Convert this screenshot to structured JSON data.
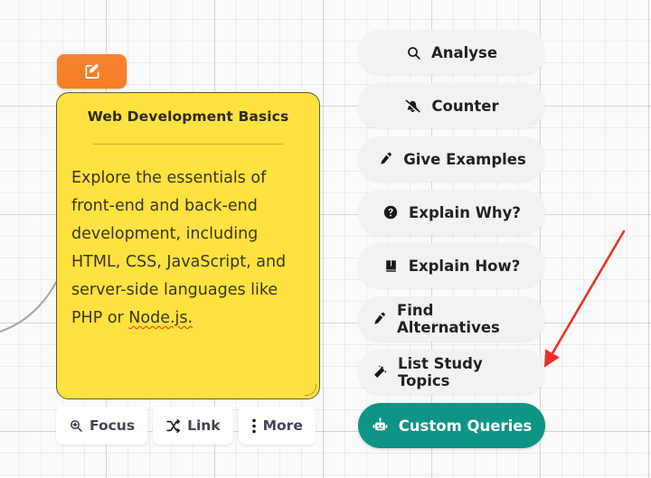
{
  "canvas": {
    "grid": true,
    "background_color": "#fafafa",
    "grid_minor_color": "#ebebeb",
    "grid_major_color": "#e0e0e0"
  },
  "connector": {
    "name": "edge-curve",
    "color": "#a8a8a8"
  },
  "edit_badge": {
    "icon": "edit-square-icon",
    "color": "#f47d24"
  },
  "note": {
    "title": "Web Development Basics",
    "body_lines": [
      "Explore the essentials of",
      "front-end and back-end",
      "development, including",
      "HTML, CSS, JavaScript, and",
      "server-side languages like",
      "PHP or "
    ],
    "misspelled_word": "Node.js.",
    "background_color": "#ffe13f",
    "border_color": "#5e5a33",
    "spellcheck_color": "#e8342a"
  },
  "note_toolbar": {
    "buttons": [
      {
        "label": "Focus",
        "icon": "magnify-plus-icon"
      },
      {
        "label": "Link",
        "icon": "shuffle-icon"
      },
      {
        "label": "More",
        "icon": "dots-vertical-icon"
      }
    ]
  },
  "action_menu": {
    "accent_color": "#0e9484",
    "items": [
      {
        "label": "Analyse",
        "icon": "search-icon",
        "active": false
      },
      {
        "label": "Counter",
        "icon": "bell-slash-icon",
        "active": false
      },
      {
        "label": "Give Examples",
        "icon": "pen-icon",
        "active": false
      },
      {
        "label": "Explain Why?",
        "icon": "question-circle-icon",
        "active": false
      },
      {
        "label": "Explain How?",
        "icon": "book-icon",
        "active": false
      },
      {
        "label": "Find Alternatives",
        "icon": "pen-icon",
        "active": false
      },
      {
        "label": "List Study Topics",
        "icon": "magic-wand-icon",
        "active": false
      },
      {
        "label": "Custom Queries",
        "icon": "robot-icon",
        "active": true
      }
    ]
  },
  "annotation": {
    "name": "red-arrow",
    "color": "#ee3124",
    "points_at": "List Study Topics"
  }
}
